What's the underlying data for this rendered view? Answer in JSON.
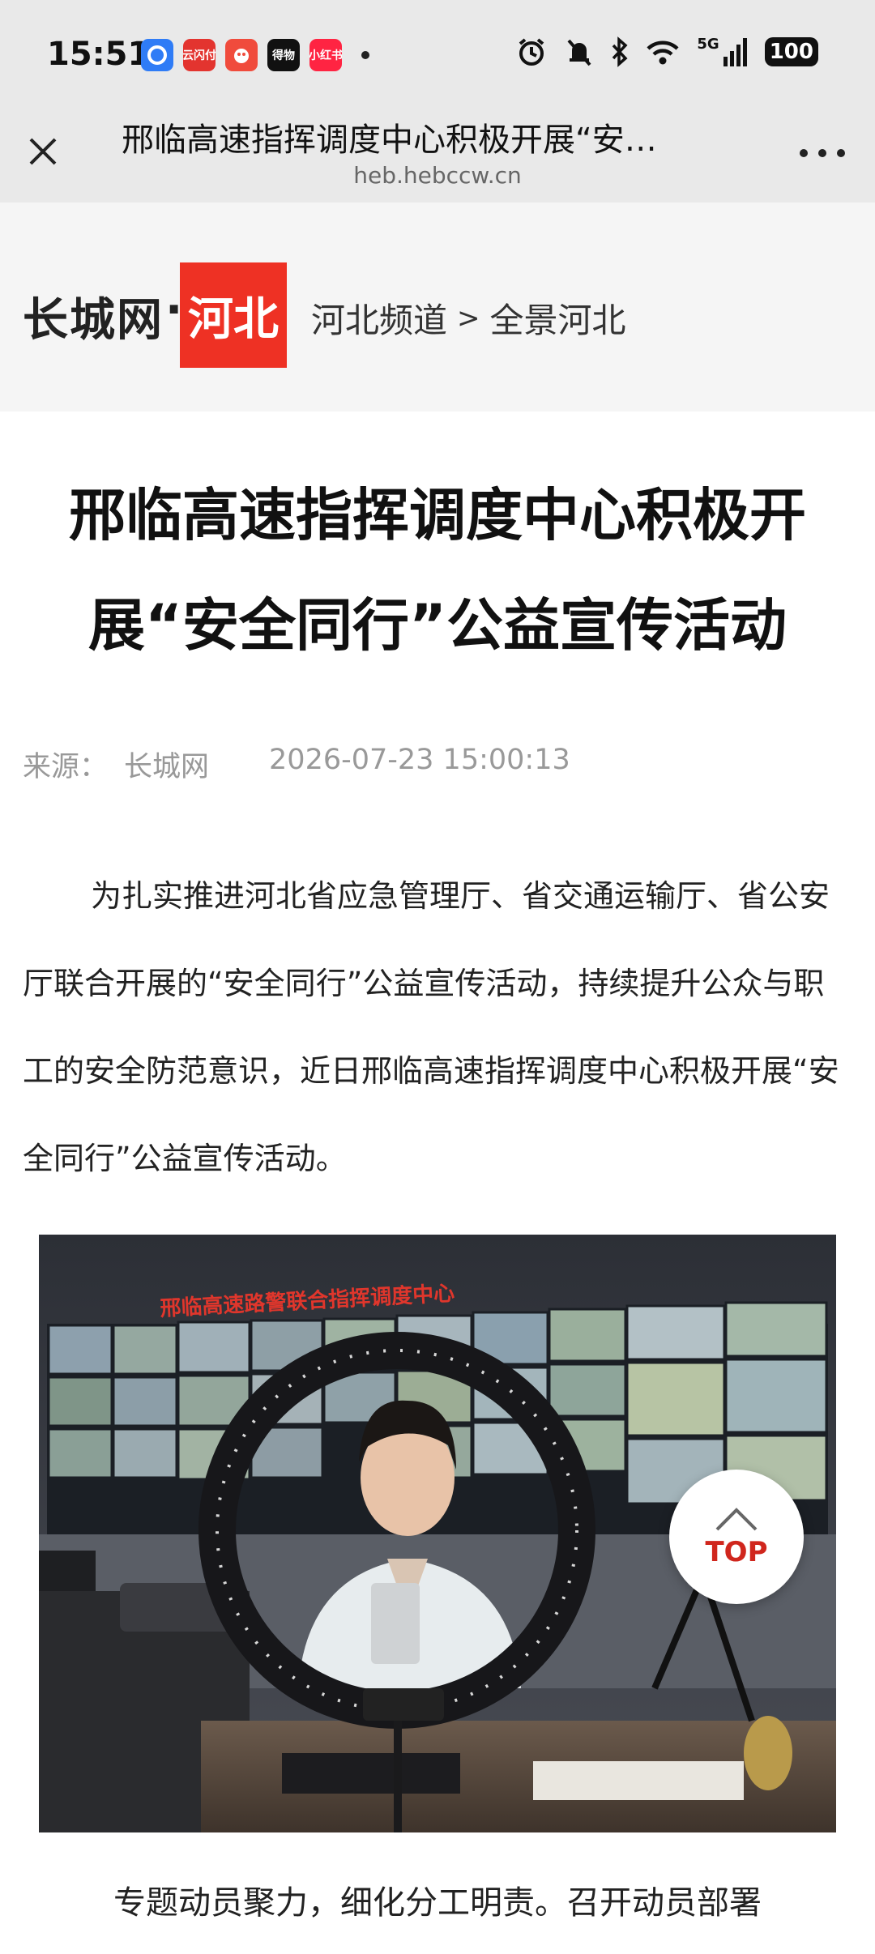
{
  "status_bar": {
    "time": "15:51",
    "apps": [
      {
        "name": "app-icon-1",
        "label": "",
        "color": "#2f7cf6"
      },
      {
        "name": "app-icon-2",
        "label": "云闪付",
        "color": "#e3342f"
      },
      {
        "name": "app-icon-3",
        "label": "",
        "color": "#f04b3c"
      },
      {
        "name": "app-icon-4",
        "label": "得物",
        "color": "#111111"
      },
      {
        "name": "app-icon-5",
        "label": "小红书",
        "color": "#ff2442"
      }
    ],
    "network": "5G",
    "battery": "100"
  },
  "browser": {
    "page_title": "邢临高速指挥调度中心积极开展“安…",
    "domain": "heb.hebccw.cn"
  },
  "site": {
    "logo_text": "长城网",
    "logo_dot": "·",
    "logo_badge": "河北",
    "breadcrumb": [
      "河北频道",
      "全景河北"
    ],
    "breadcrumb_sep": ">"
  },
  "article": {
    "title": "邢临高速指挥调度中心积极开展“安全同行”公益宣传活动",
    "source_label": "来源：",
    "source": "长城网",
    "datetime": "2026-07-23 15:00:13",
    "paragraph": "为扎实推进河北省应急管理厅、省交通运输厅、省公安厅联合开展的“安全同行”公益宣传活动，持续提升公众与职工的安全防范意识，近日邢临高速指挥调度中心积极开展“安全同行”公益宣传活动。",
    "photo_banner": "邢临高速路警联合指挥调度中心",
    "caption": "专题动员聚力，细化分工明责。召开动员部署"
  },
  "top_button": {
    "label": "TOP"
  },
  "colors": {
    "brand_red": "#ee3124",
    "top_red": "#d0261d",
    "bar_gray": "#e9e9e9",
    "header_gray": "#f5f5f5"
  }
}
